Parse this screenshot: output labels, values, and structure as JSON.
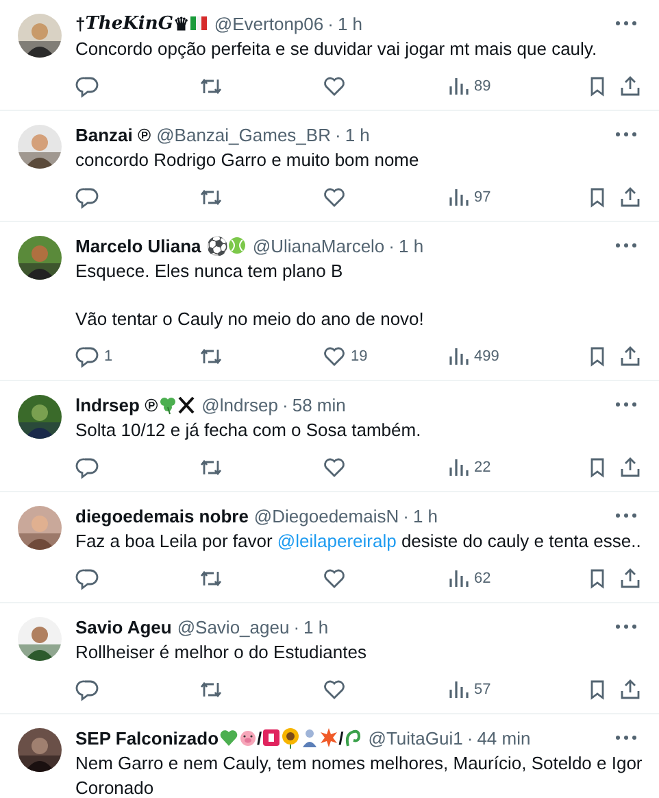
{
  "replies": [
    {
      "name_parts": [
        {
          "kind": "text",
          "text": "†"
        },
        {
          "kind": "italic",
          "text": "TheKinG"
        },
        {
          "kind": "text",
          "text": "♛"
        },
        {
          "kind": "flag"
        }
      ],
      "handle": "@Evertonp06",
      "dot": "·",
      "time": "1 h",
      "body": [
        [
          {
            "kind": "text",
            "text": "Concordo opção perfeita e se duvidar vai jogar mt  mais que cauly."
          }
        ]
      ],
      "actions": {
        "views": "89"
      }
    },
    {
      "name_parts": [
        {
          "kind": "text",
          "text": "Banzai ℗"
        }
      ],
      "handle": "@Banzai_Games_BR",
      "dot": "·",
      "time": "1 h",
      "body": [
        [
          {
            "kind": "text",
            "text": "concordo Rodrigo Garro e muito bom nome"
          }
        ]
      ],
      "actions": {
        "views": "97"
      }
    },
    {
      "name_parts": [
        {
          "kind": "text",
          "text": "Marcelo Uliana ⚽"
        },
        {
          "kind": "ball"
        }
      ],
      "handle": "@UlianaMarcelo",
      "dot": "·",
      "time": "1 h",
      "body": [
        [
          {
            "kind": "text",
            "text": "Esquece. Eles nunca tem plano B"
          }
        ],
        [
          {
            "kind": "text",
            "text": "Vão tentar o Cauly no meio do ano de novo!"
          }
        ]
      ],
      "actions": {
        "replies": "1",
        "likes": "19",
        "views": "499"
      }
    },
    {
      "name_parts": [
        {
          "kind": "text",
          "text": "lndrsep ℗"
        },
        {
          "kind": "clover"
        },
        {
          "kind": "xmark"
        }
      ],
      "handle": "@lndrsep",
      "dot": "·",
      "time": "58 min",
      "body": [
        [
          {
            "kind": "text",
            "text": "Solta 10/12 e já fecha com o Sosa também."
          }
        ]
      ],
      "actions": {
        "views": "22"
      }
    },
    {
      "name_parts": [
        {
          "kind": "text",
          "text": "diegoedemais nobre"
        }
      ],
      "handle": "@DiegoedemaisN",
      "dot": "·",
      "time": "1 h",
      "body": [
        [
          {
            "kind": "text",
            "text": "Faz a boa Leila por favor "
          },
          {
            "kind": "mention",
            "text": "@leilapereiralp"
          },
          {
            "kind": "text",
            "text": " desiste do cauly e tenta esse.."
          }
        ]
      ],
      "actions": {
        "views": "62"
      }
    },
    {
      "name_parts": [
        {
          "kind": "text",
          "text": "Savio Ageu"
        }
      ],
      "handle": "@Savio_ageu",
      "dot": "·",
      "time": "1 h",
      "body": [
        [
          {
            "kind": "text",
            "text": "Rollheiser é melhor o do Estudiantes"
          }
        ]
      ],
      "actions": {
        "views": "57"
      }
    },
    {
      "name_parts": [
        {
          "kind": "text",
          "text": "SEP Falconizado"
        },
        {
          "kind": "heart"
        },
        {
          "kind": "pig"
        },
        {
          "kind": "text",
          "text": "/"
        },
        {
          "kind": "bsquare"
        },
        {
          "kind": "flower"
        },
        {
          "kind": "person"
        },
        {
          "kind": "burst"
        },
        {
          "kind": "text",
          "text": "/"
        },
        {
          "kind": "snake"
        }
      ],
      "handle": "@TuitaGui1",
      "dot": "·",
      "time": "44 min",
      "body": [
        [
          {
            "kind": "text",
            "text": "Nem Garro e nem Cauly, tem nomes melhores, Maurício, Soteldo e Igor Coronado"
          }
        ]
      ]
    }
  ]
}
